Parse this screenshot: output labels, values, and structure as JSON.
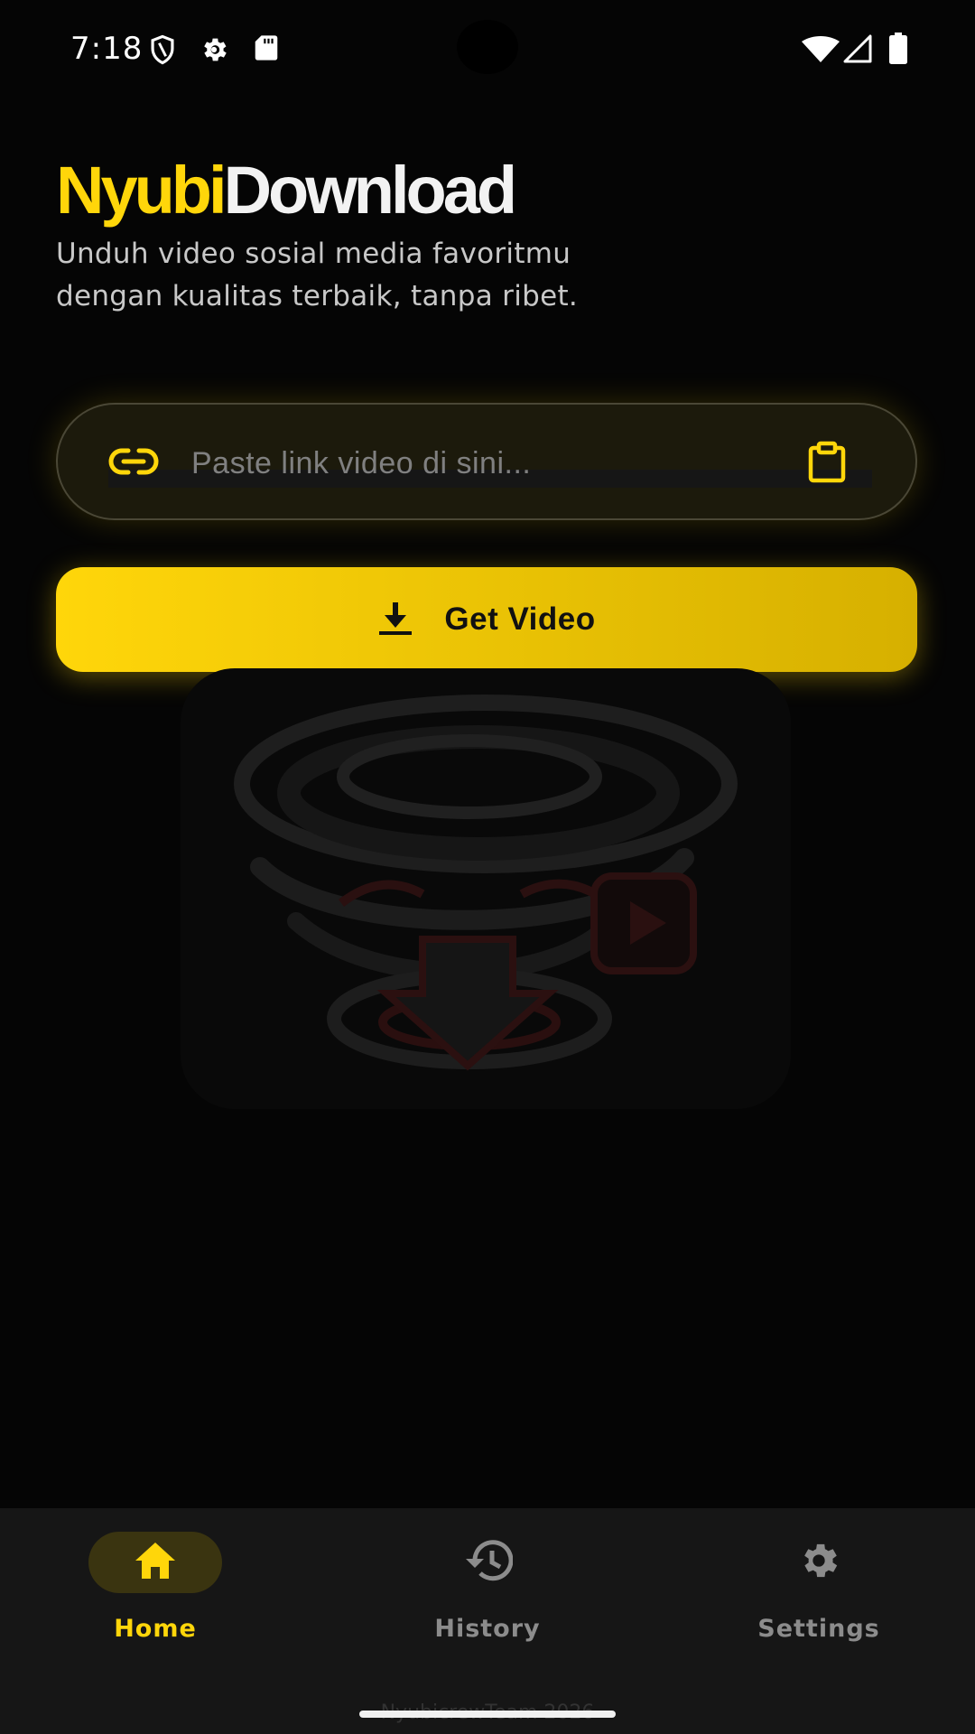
{
  "status_bar": {
    "time": "7:18",
    "left_icons": [
      "shield-icon",
      "gear-icon",
      "sd-card-icon"
    ],
    "right_icons": [
      "wifi-icon",
      "signal-icon",
      "battery-icon"
    ]
  },
  "header": {
    "brand_part1": "Nyubi",
    "brand_part2": "Download",
    "subtitle_line1": "Unduh video sosial media favoritmu",
    "subtitle_line2": "dengan kualitas terbaik, tanpa ribet."
  },
  "link_input": {
    "placeholder": "Paste link video di sini...",
    "value": "",
    "leading_icon": "link-icon",
    "trailing_icon": "clipboard-icon"
  },
  "get_video_button": {
    "label": "Get Video",
    "icon": "download-icon"
  },
  "bottom_nav": {
    "items": [
      {
        "label": "Home",
        "icon": "home-icon",
        "active": true
      },
      {
        "label": "History",
        "icon": "history-icon",
        "active": false
      },
      {
        "label": "Settings",
        "icon": "settings-gear-icon",
        "active": false
      }
    ],
    "footer": "NyubicrewTeam 2026"
  },
  "colors": {
    "accent": "#FFD60A",
    "background": "#050505",
    "nav_background": "#161616",
    "inactive": "#8c8c8c"
  }
}
